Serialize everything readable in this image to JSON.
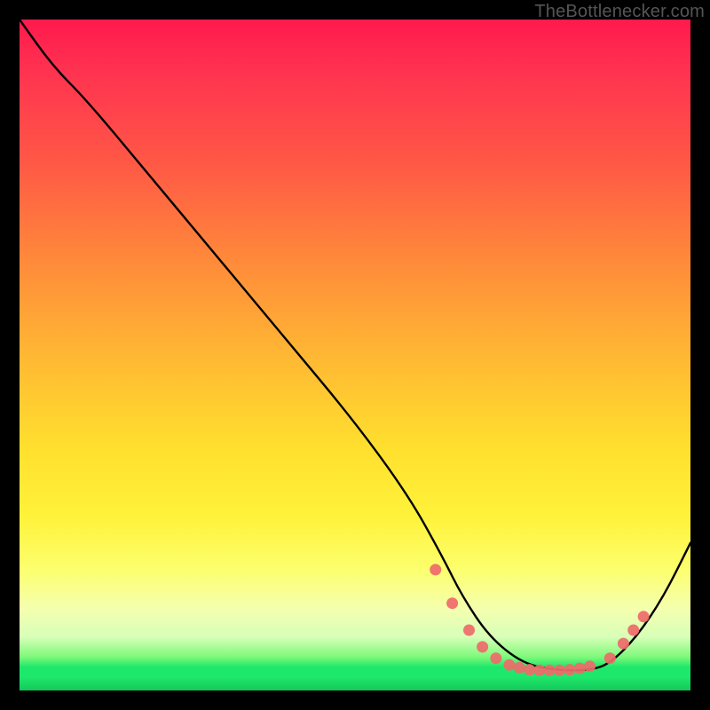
{
  "attribution": "TheBottlenecker.com",
  "chart_data": {
    "type": "line",
    "title": "",
    "xlabel": "",
    "ylabel": "",
    "xlim": [
      0,
      100
    ],
    "ylim": [
      0,
      100
    ],
    "series": [
      {
        "name": "curve",
        "x": [
          0,
          5,
          10,
          20,
          30,
          40,
          50,
          58,
          63,
          66,
          70,
          75,
          80,
          85,
          88,
          92,
          96,
          100
        ],
        "y": [
          100,
          93,
          88,
          76,
          64,
          52,
          40,
          29,
          20,
          14,
          8,
          4,
          3,
          3,
          4,
          8,
          14,
          22
        ]
      }
    ],
    "markers": {
      "name": "dots",
      "x": [
        62,
        64.5,
        67,
        69,
        71,
        73,
        74.5,
        76,
        77.5,
        79,
        80.5,
        82,
        83.5,
        85,
        88,
        90,
        91.5,
        93
      ],
      "y": [
        18,
        13,
        9,
        6.5,
        4.8,
        3.8,
        3.4,
        3.1,
        3.0,
        3.0,
        3.0,
        3.1,
        3.3,
        3.6,
        4.8,
        7,
        9,
        11
      ]
    }
  }
}
